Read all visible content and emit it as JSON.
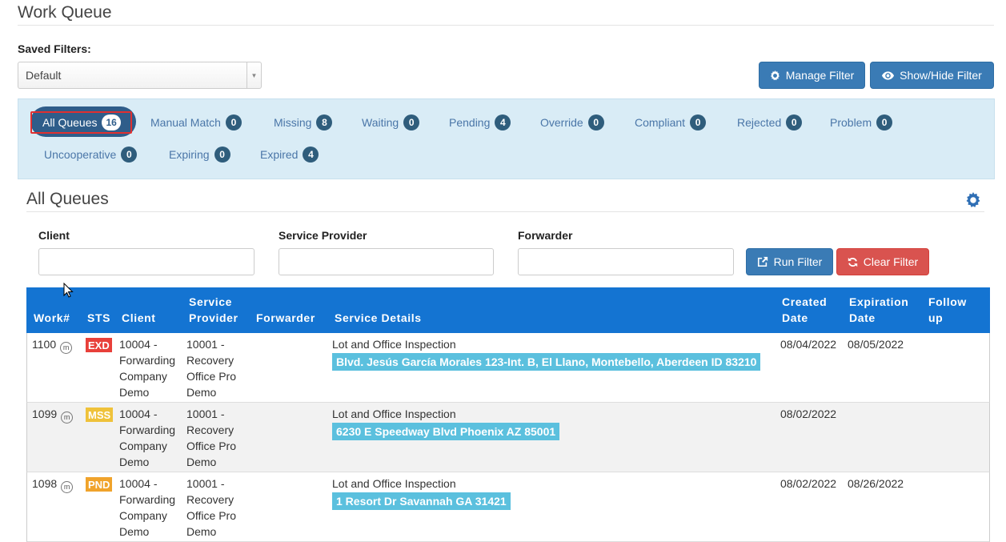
{
  "page": {
    "title": "Work Queue"
  },
  "saved_filters": {
    "label": "Saved Filters:",
    "value": "Default"
  },
  "actions": {
    "manage_filter": "Manage Filter",
    "show_hide_filter": "Show/Hide Filter"
  },
  "queues": [
    {
      "label": "All Queues",
      "count": "16",
      "active": true
    },
    {
      "label": "Manual Match",
      "count": "0"
    },
    {
      "label": "Missing",
      "count": "8"
    },
    {
      "label": "Waiting",
      "count": "0"
    },
    {
      "label": "Pending",
      "count": "4"
    },
    {
      "label": "Override",
      "count": "0"
    },
    {
      "label": "Compliant",
      "count": "0"
    },
    {
      "label": "Rejected",
      "count": "0"
    },
    {
      "label": "Problem",
      "count": "0"
    },
    {
      "label": "Uncooperative",
      "count": "0"
    },
    {
      "label": "Expiring",
      "count": "0"
    },
    {
      "label": "Expired",
      "count": "4"
    }
  ],
  "section": {
    "title": "All Queues"
  },
  "filters": {
    "client_label": "Client",
    "service_provider_label": "Service Provider",
    "forwarder_label": "Forwarder",
    "client_value": "",
    "service_provider_value": "",
    "forwarder_value": "",
    "run_filter": "Run Filter",
    "clear_filter": "Clear Filter"
  },
  "table": {
    "headers": {
      "work": "Work#",
      "sts": "STS",
      "client": "Client",
      "service_provider_1": "Service",
      "service_provider_2": "Provider",
      "forwarder": "Forwarder",
      "service_details": "Service Details",
      "created_1": "Created",
      "created_2": "Date",
      "expiration_1": "Expiration",
      "expiration_2": "Date",
      "follow_1": "Follow",
      "follow_2": "up"
    },
    "m_icon": "m",
    "rows": [
      {
        "work": "1100",
        "sts": "EXD",
        "sts_color": "#e8403a",
        "client": [
          "10004 -",
          "Forwarding",
          "Company",
          "Demo"
        ],
        "provider": [
          "10001 -",
          "Recovery",
          "Office Pro",
          "Demo"
        ],
        "forwarder": "",
        "service": "Lot and Office Inspection",
        "address": "Blvd. Jesús García Morales 123-Int. B, El Llano, Montebello, Aberdeen ID 83210",
        "created": "08/04/2022",
        "expiration": "08/05/2022",
        "follow_up": ""
      },
      {
        "work": "1099",
        "sts": "MSS",
        "sts_color": "#efc23a",
        "client": [
          "10004 -",
          "Forwarding",
          "Company",
          "Demo"
        ],
        "provider": [
          "10001 -",
          "Recovery",
          "Office Pro",
          "Demo"
        ],
        "forwarder": "",
        "service": "Lot and Office Inspection",
        "address": "6230 E Speedway Blvd Phoenix AZ 85001",
        "created": "08/02/2022",
        "expiration": "",
        "follow_up": ""
      },
      {
        "work": "1098",
        "sts": "PND",
        "sts_color": "#f0a32b",
        "client": [
          "10004 -",
          "Forwarding",
          "Company",
          "Demo"
        ],
        "provider": [
          "10001 -",
          "Recovery",
          "Office Pro",
          "Demo"
        ],
        "forwarder": "",
        "service": "Lot and Office Inspection",
        "address": "1 Resort Dr Savannah GA 31421",
        "created": "08/02/2022",
        "expiration": "08/26/2022",
        "follow_up": ""
      }
    ]
  }
}
